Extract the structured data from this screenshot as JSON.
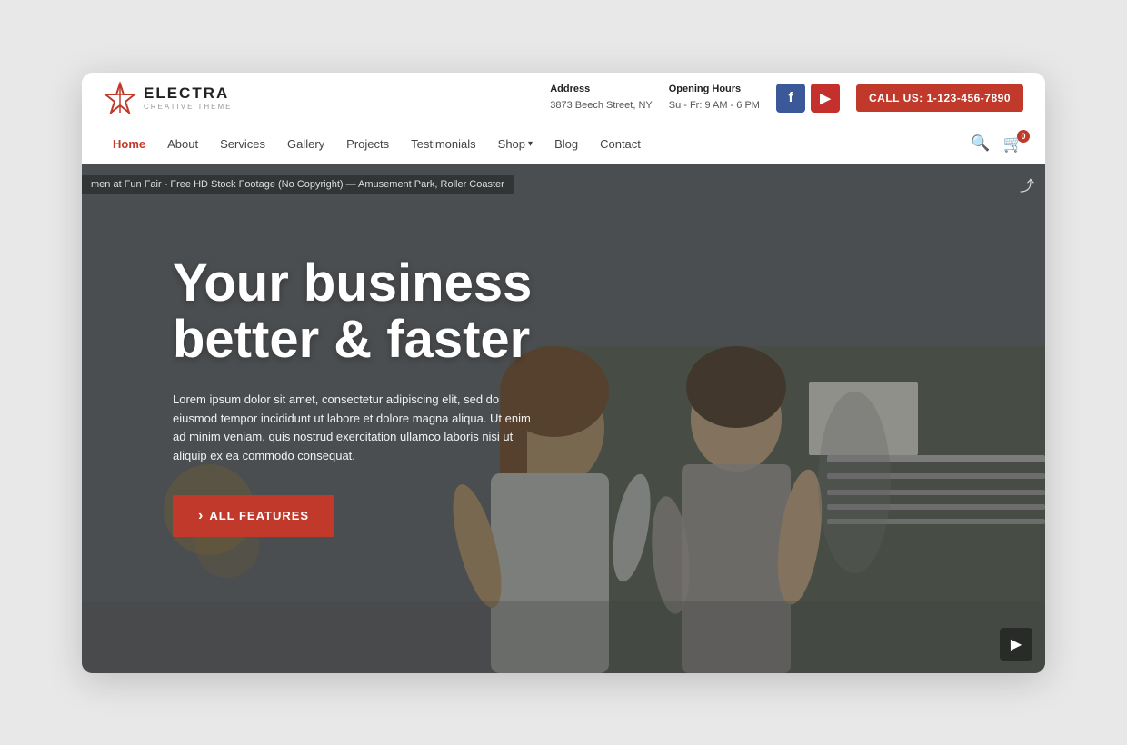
{
  "browser": {
    "shadow": true
  },
  "header": {
    "logo_name": "ELECTRA",
    "logo_sub": "CREATIVE THEME",
    "address_label": "Address",
    "address_value": "3873 Beech Street, NY",
    "hours_label": "Opening Hours",
    "hours_value": "Su - Fr: 9 AM - 6 PM",
    "call_label": "CALL US: 1-123-456-7890",
    "cart_count": "0"
  },
  "nav": {
    "items": [
      {
        "label": "Home",
        "active": true
      },
      {
        "label": "About",
        "active": false
      },
      {
        "label": "Services",
        "active": false
      },
      {
        "label": "Gallery",
        "active": false
      },
      {
        "label": "Projects",
        "active": false
      },
      {
        "label": "Testimonials",
        "active": false
      },
      {
        "label": "Shop",
        "active": false,
        "has_dropdown": true
      },
      {
        "label": "Blog",
        "active": false
      },
      {
        "label": "Contact",
        "active": false
      }
    ]
  },
  "hero": {
    "video_caption": "men at Fun Fair - Free HD Stock Footage (No Copyright) — Amusement Park, Roller Coaster",
    "title_line1": "Your business",
    "title_line2": "better & faster",
    "description": "Lorem ipsum dolor sit amet, consectetur adipiscing elit, sed do eiusmod tempor incididunt ut labore et dolore magna aliqua. Ut enim ad minim veniam, quis nostrud exercitation ullamco laboris nisi ut aliquip ex ea commodo consequat.",
    "cta_label": "ALL FEATURES"
  },
  "social": {
    "facebook_label": "f",
    "youtube_label": "▶"
  }
}
